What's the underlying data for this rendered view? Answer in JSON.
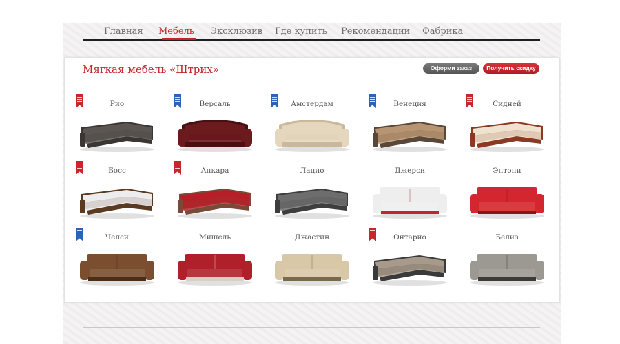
{
  "nav": {
    "items": [
      {
        "label": "Главная",
        "active": false
      },
      {
        "label": "Мебель",
        "active": true
      },
      {
        "label": "Эксклюзив",
        "active": false
      },
      {
        "label": "Где купить",
        "active": false
      },
      {
        "label": "Рекомендации",
        "active": false
      },
      {
        "label": "Фабрика",
        "active": false
      }
    ]
  },
  "page": {
    "title": "Мягкая мебель «Штрих»",
    "order_button": "Оформи заказ",
    "discount_button": "Получить скидку"
  },
  "colors": {
    "accent": "#c2252a",
    "badge_red": "#c8262c",
    "badge_blue": "#2a63b8",
    "nav_text": "#6b6b6b"
  },
  "products": [
    {
      "name": "Рио",
      "badge": "red",
      "fabric": "#5b5651",
      "trim": "#3a3633",
      "shape": "corner"
    },
    {
      "name": "Версаль",
      "badge": "blue",
      "fabric": "#6b1a1e",
      "trim": "#4a0f12",
      "shape": "round"
    },
    {
      "name": "Амстердам",
      "badge": "blue",
      "fabric": "#e4d7be",
      "trim": "#c9b89a",
      "shape": "round"
    },
    {
      "name": "Венеция",
      "badge": "blue",
      "fabric": "#b89572",
      "trim": "#5a4738",
      "shape": "corner"
    },
    {
      "name": "Сидней",
      "badge": "red",
      "fabric": "#efe3cf",
      "trim": "#8a3a22",
      "shape": "corner"
    },
    {
      "name": "Босс",
      "badge": "red",
      "fabric": "#ededed",
      "trim": "#5b3a22",
      "shape": "corner"
    },
    {
      "name": "Анкара",
      "badge": "red",
      "fabric": "#b71f28",
      "trim": "#7a4a38",
      "shape": "corner"
    },
    {
      "name": "Лацио",
      "badge": "none",
      "fabric": "#6d6d6d",
      "trim": "#3e3e3e",
      "shape": "corner"
    },
    {
      "name": "Джерси",
      "badge": "none",
      "fabric": "#eeeeee",
      "trim": "#c2252a",
      "shape": "straight"
    },
    {
      "name": "Энтони",
      "badge": "none",
      "fabric": "#d4262e",
      "trim": "#8d1318",
      "shape": "straight"
    },
    {
      "name": "Челси",
      "badge": "blue",
      "fabric": "#7a4e2e",
      "trim": "#4c2e17",
      "shape": "straight"
    },
    {
      "name": "Мишель",
      "badge": "none",
      "fabric": "#b0202a",
      "trim": "#d9cfc3",
      "shape": "straight"
    },
    {
      "name": "Джастин",
      "badge": "none",
      "fabric": "#d8c8a8",
      "trim": "#7a6a4c",
      "shape": "straight"
    },
    {
      "name": "Онтарио",
      "badge": "red",
      "fabric": "#a89a8a",
      "trim": "#3a3a3a",
      "shape": "corner"
    },
    {
      "name": "Белиз",
      "badge": "none",
      "fabric": "#9c9892",
      "trim": "#3e3a36",
      "shape": "straight"
    }
  ]
}
